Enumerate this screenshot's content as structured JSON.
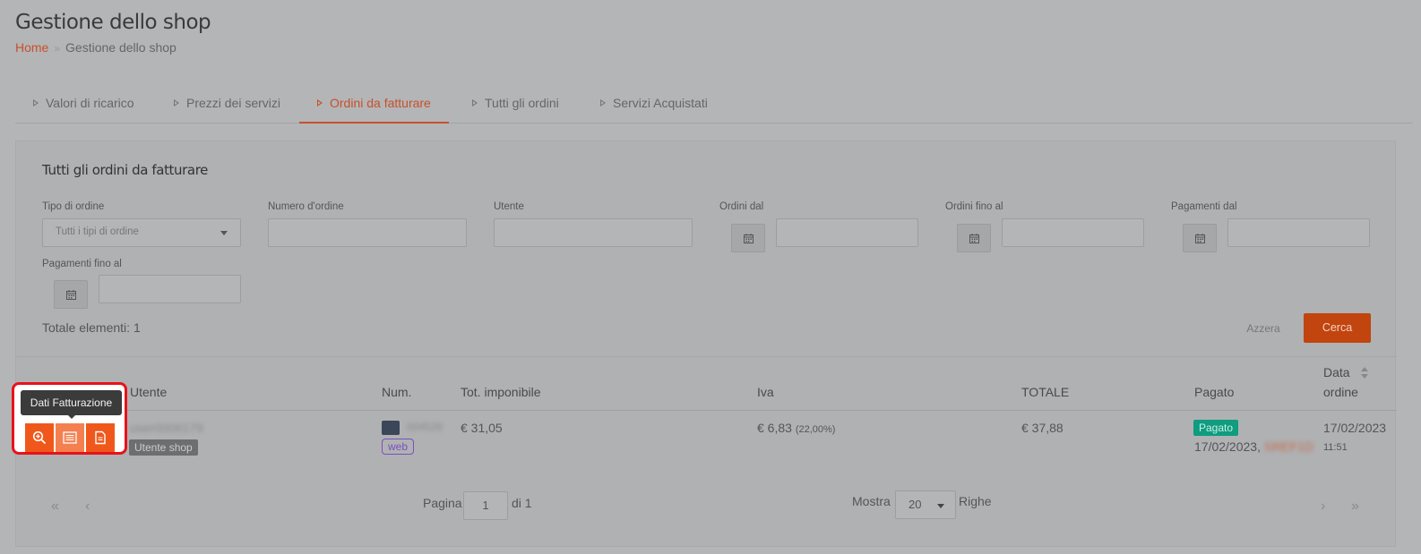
{
  "header": {
    "title": "Gestione dello shop"
  },
  "breadcrumb": {
    "home": "Home",
    "separator": "»",
    "current": "Gestione dello shop"
  },
  "tabs": [
    {
      "label": "Valori di ricarico"
    },
    {
      "label": "Prezzi dei servizi"
    },
    {
      "label": "Ordini da fatturare",
      "active": true
    },
    {
      "label": "Tutti gli ordini"
    },
    {
      "label": "Servizi Acquistati"
    }
  ],
  "panel": {
    "title": "Tutti gli ordini da fatturare"
  },
  "filters": {
    "tipo_label": "Tipo di ordine",
    "tipo_value": "Tutti i tipi di ordine",
    "numero_label": "Numero d'ordine",
    "numero_value": "",
    "utente_label": "Utente",
    "utente_value": "",
    "ordini_dal_label": "Ordini dal",
    "ordini_fino_label": "Ordini fino al",
    "pagamenti_dal_label": "Pagamenti dal",
    "pagamenti_fino_label": "Pagamenti fino al"
  },
  "totale": "Totale elementi: 1",
  "buttons": {
    "azzera": "Azzera",
    "cerca": "Cerca"
  },
  "table": {
    "headers": {
      "utente": "Utente",
      "num": "Num.",
      "tot_imponibile": "Tot. imponibile",
      "iva": "Iva",
      "totale": "TOTALE",
      "pagato": "Pagato",
      "data_line1": "Data",
      "data_line2": "ordine"
    },
    "rows": [
      {
        "utente_name": "user0006179",
        "utente_badge": "Utente shop",
        "num_id": "0",
        "num_code": "004528",
        "num_source": "web",
        "tot_imponibile": "€ 31,05",
        "iva": "€ 6,83",
        "iva_rate": "(22,00%)",
        "totale": "€ 37,88",
        "pagato_badge": "Pagato",
        "pagato_date": "17/02/2023,",
        "pagato_ref": "SREF1D",
        "data_date": "17/02/2023",
        "data_time": "11:51"
      }
    ]
  },
  "tooltip": "Dati Fatturazione",
  "pagination": {
    "pagina_label": "Pagina",
    "page": "1",
    "of_label": "di 1",
    "mostra_label": "Mostra",
    "per_page": "20",
    "righe_label": "Righe",
    "first": "«",
    "prev": "‹",
    "next": "›",
    "last": "»"
  },
  "colors": {
    "accent": "#c7502a",
    "action": "#f0581b",
    "paid": "#0f9c7f",
    "highlight": "#e8121a"
  }
}
